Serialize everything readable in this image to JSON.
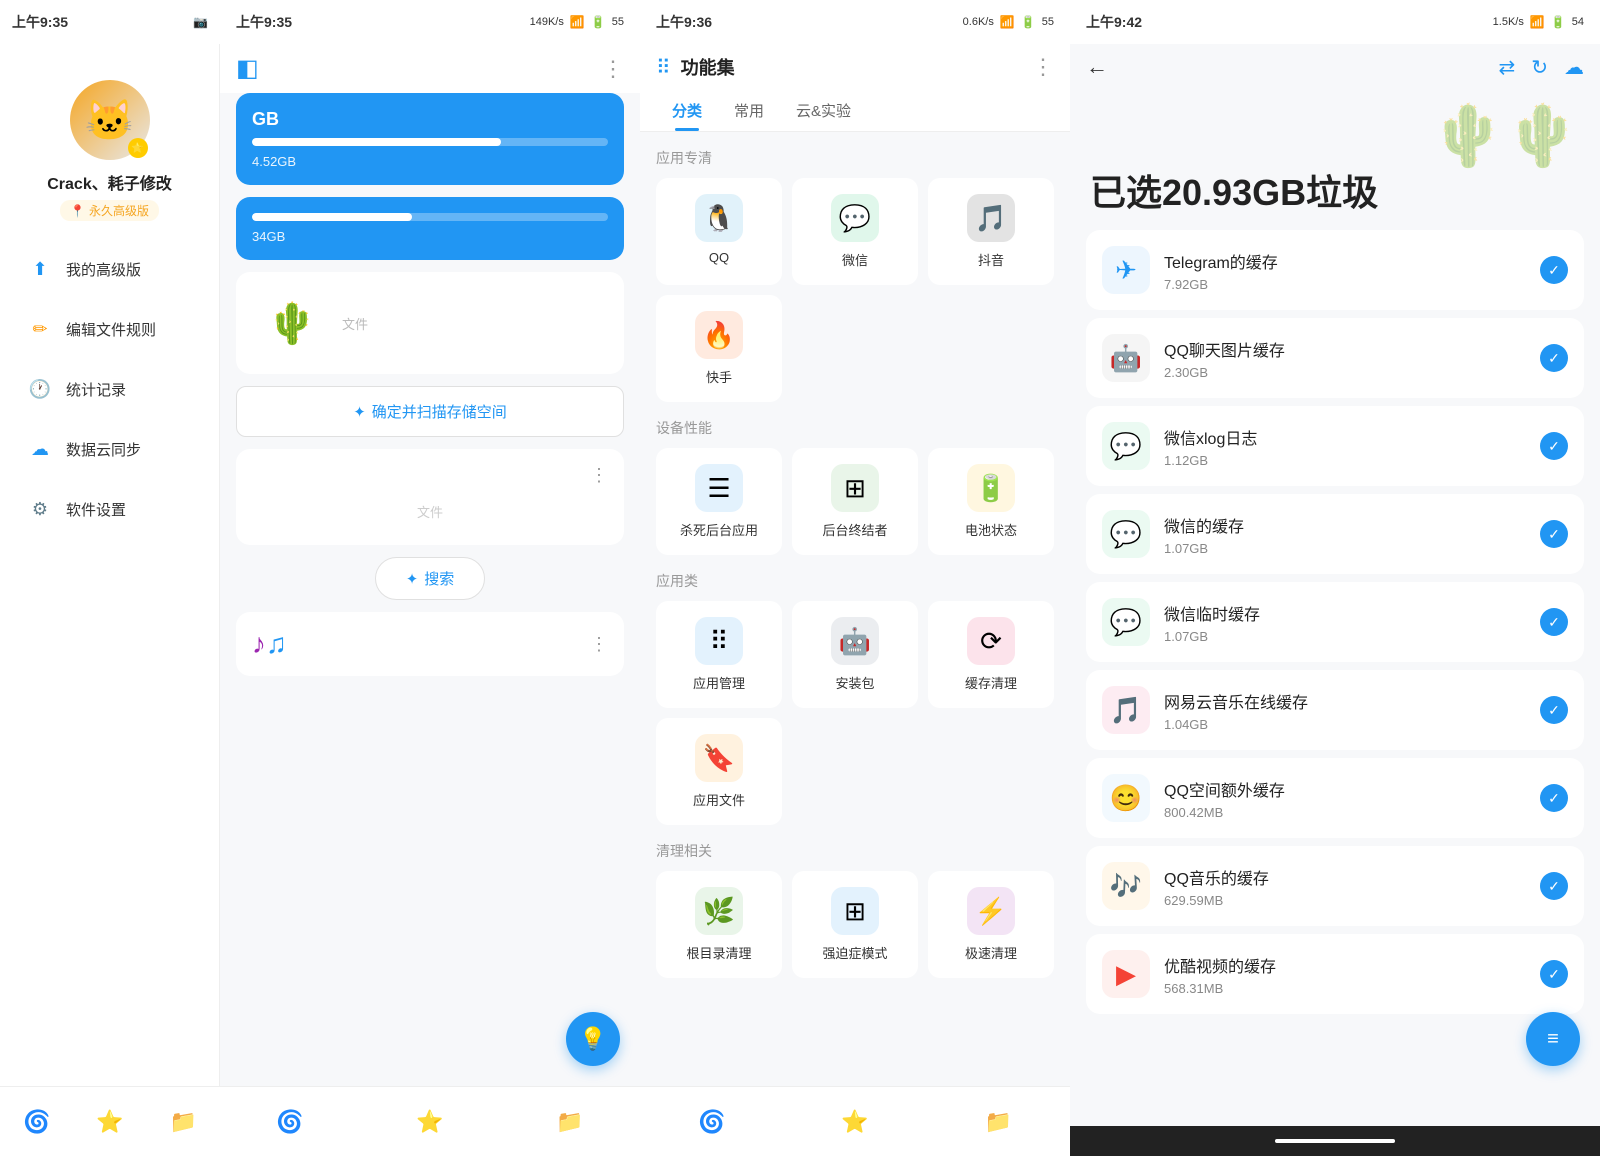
{
  "panel1": {
    "status": {
      "time": "上午9:35",
      "icons": [
        "📷",
        "◀"
      ]
    },
    "user": {
      "avatar_emoji": "🐱",
      "name": "Crack、耗子修改",
      "tag_icon": "📍",
      "tag": "永久高级版"
    },
    "menu": [
      {
        "id": "premium",
        "icon": "⬆️",
        "label": "我的高级版",
        "color": "#2196f3"
      },
      {
        "id": "rules",
        "icon": "✏️",
        "label": "编辑文件规则",
        "color": "#ff9800"
      },
      {
        "id": "stats",
        "icon": "🕐",
        "label": "统计记录",
        "color": "#4caf50"
      },
      {
        "id": "cloud",
        "icon": "☁️",
        "label": "数据云同步",
        "color": "#2196f3"
      },
      {
        "id": "settings",
        "icon": "⚙️",
        "label": "软件设置",
        "color": "#607d8b"
      }
    ],
    "nav": [
      {
        "id": "fan",
        "label": "🌀",
        "active": true
      },
      {
        "id": "star",
        "label": "⭐",
        "active": false
      },
      {
        "id": "folder",
        "label": "📁",
        "active": false
      }
    ]
  },
  "panel2": {
    "status": {
      "time": "上午9:35",
      "speed": "149K/s",
      "battery": "55"
    },
    "header": {
      "icon1": "◧",
      "icon2": "⋮"
    },
    "storage_card1": {
      "title": "GB",
      "bar_percent": 70,
      "label": "4.52GB"
    },
    "storage_card2": {
      "bar_percent": 45,
      "label": "34GB"
    },
    "scan_btn": "确定并扫描存储空间",
    "file_section": {
      "dots": "⋮",
      "label": "文件"
    },
    "search": {
      "icon": "✦",
      "label": "搜索"
    },
    "music_section": {
      "note1": "♪",
      "note2": "♫",
      "dots": "⋮"
    },
    "floating_btn": {
      "icon": "💡"
    },
    "nav": [
      {
        "id": "fan",
        "label": "🌀"
      },
      {
        "id": "star",
        "label": "⭐"
      },
      {
        "id": "folder",
        "label": "📁"
      }
    ]
  },
  "panel3": {
    "status": {
      "time": "上午9:36",
      "speed": "0.6K/s",
      "battery": "55"
    },
    "header": {
      "grid_icon": "⠿",
      "title": "功能集",
      "more_icon": "⋮"
    },
    "tabs": [
      {
        "id": "category",
        "label": "分类",
        "active": true
      },
      {
        "id": "common",
        "label": "常用",
        "active": false
      },
      {
        "id": "cloud",
        "label": "云&实验",
        "active": false
      }
    ],
    "sections": [
      {
        "id": "app-clean",
        "title": "应用专清",
        "items": [
          {
            "id": "qq",
            "icon": "🐧",
            "label": "QQ",
            "bg": "#1296db"
          },
          {
            "id": "wechat",
            "icon": "💬",
            "label": "微信",
            "bg": "#07c160"
          },
          {
            "id": "douyin",
            "icon": "🎵",
            "label": "抖音",
            "bg": "#000"
          },
          {
            "id": "kuaishou",
            "icon": "🔥",
            "label": "快手",
            "bg": "#ff5500"
          }
        ]
      },
      {
        "id": "device-perf",
        "title": "设备性能",
        "items": [
          {
            "id": "kill-bg",
            "icon": "☰",
            "label": "杀死后台应用",
            "bg": "#2196f3"
          },
          {
            "id": "bg-killer",
            "icon": "⊞",
            "label": "后台终结者",
            "bg": "#4caf50"
          },
          {
            "id": "battery",
            "icon": "🔋",
            "label": "电池状态",
            "bg": "#ffc107"
          }
        ]
      },
      {
        "id": "app-class",
        "title": "应用类",
        "items": [
          {
            "id": "app-mgr",
            "icon": "⠿",
            "label": "应用管理",
            "bg": "#2196f3"
          },
          {
            "id": "apk",
            "icon": "🤖",
            "label": "安装包",
            "bg": "#607d8b"
          },
          {
            "id": "cache-clean",
            "icon": "⟳",
            "label": "缓存清理",
            "bg": "#e91e63"
          },
          {
            "id": "app-files",
            "icon": "🔖",
            "label": "应用文件",
            "bg": "#ff9800"
          }
        ]
      },
      {
        "id": "clean-related",
        "title": "清理相关",
        "items": [
          {
            "id": "dir-clean",
            "icon": "🌿",
            "label": "根目录清理",
            "bg": "#4caf50"
          },
          {
            "id": "ocd-mode",
            "icon": "⊞",
            "label": "强迫症模式",
            "bg": "#2196f3"
          },
          {
            "id": "fast-clean",
            "icon": "⚡",
            "label": "极速清理",
            "bg": "#9c27b0"
          }
        ]
      }
    ],
    "nav": [
      {
        "id": "fan",
        "label": "🌀"
      },
      {
        "id": "star",
        "label": "⭐"
      },
      {
        "id": "folder",
        "label": "📁"
      }
    ]
  },
  "panel4": {
    "status": {
      "time": "上午9:42",
      "speed": "1.5K/s",
      "battery": "54"
    },
    "header": {
      "back_icon": "←",
      "icon1": "⇄",
      "icon2": "↻",
      "icon3": "☁"
    },
    "hero": {
      "title": "已选20.93GB垃圾",
      "cactus": "🌵"
    },
    "items": [
      {
        "id": "telegram",
        "icon": "✈",
        "icon_bg": "#2196f3",
        "name": "Telegram的缓存",
        "size": "7.92GB"
      },
      {
        "id": "qq-chat",
        "icon": "🤖",
        "icon_bg": "#888",
        "name": "QQ聊天图片缓存",
        "size": "2.30GB"
      },
      {
        "id": "wechat-xlog",
        "icon": "💬",
        "icon_bg": "#07c160",
        "name": "微信xlog日志",
        "size": "1.12GB"
      },
      {
        "id": "wechat-cache",
        "icon": "💬",
        "icon_bg": "#07c160",
        "name": "微信的缓存",
        "size": "1.07GB"
      },
      {
        "id": "wechat-tmp",
        "icon": "💬",
        "icon_bg": "#07c160",
        "name": "微信临时缓存",
        "size": "1.07GB"
      },
      {
        "id": "netease",
        "icon": "🎵",
        "icon_bg": "#e91e63",
        "name": "网易云音乐在线缓存",
        "size": "1.04GB"
      },
      {
        "id": "qq-zone",
        "icon": "😊",
        "icon_bg": "#64b5f6",
        "name": "QQ空间额外缓存",
        "size": "800.42MB"
      },
      {
        "id": "qq-music",
        "icon": "🎶",
        "icon_bg": "#ff9800",
        "name": "QQ音乐的缓存",
        "size": "629.59MB"
      },
      {
        "id": "youku",
        "icon": "▶",
        "icon_bg": "#f44336",
        "name": "优酷视频的缓存",
        "size": "568.31MB"
      }
    ],
    "fab": {
      "icon": "≡"
    }
  }
}
